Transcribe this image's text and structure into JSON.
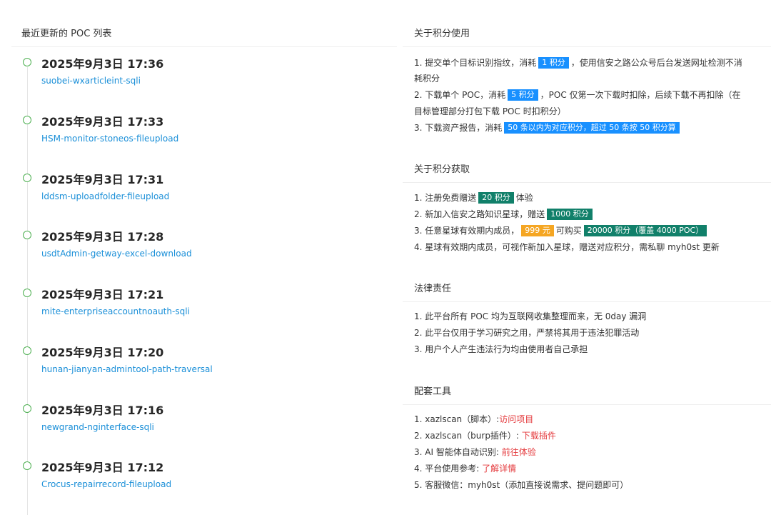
{
  "left": {
    "header": "最近更新的 POC 列表",
    "items": [
      {
        "time": "2025年9月3日 17:36",
        "name": "suobei-wxarticleint-sqli"
      },
      {
        "time": "2025年9月3日 17:33",
        "name": "HSM-monitor-stoneos-fileupload"
      },
      {
        "time": "2025年9月3日 17:31",
        "name": "lddsm-uploadfolder-fileupload"
      },
      {
        "time": "2025年9月3日 17:28",
        "name": "usdtAdmin-getway-excel-download"
      },
      {
        "time": "2025年9月3日 17:21",
        "name": "mite-enterpriseaccountnoauth-sqli"
      },
      {
        "time": "2025年9月3日 17:20",
        "name": "hunan-jianyan-admintool-path-traversal"
      },
      {
        "time": "2025年9月3日 17:16",
        "name": "newgrand-nginterface-sqli"
      },
      {
        "time": "2025年9月3日 17:12",
        "name": "Crocus-repairrecord-fileupload"
      }
    ]
  },
  "usage": {
    "title": "关于积分使用",
    "l1_pre": "1. 提交单个目标识别指纹，消耗",
    "l1_badge": "1 积分",
    "l1_post": "，使用信安之路公众号后台发送网址检测不消",
    "l1_cont": "耗积分",
    "l2_pre": "2. 下载单个 POC，消耗",
    "l2_badge": "5 积分",
    "l2_post": "，POC 仅第一次下载时扣除，后续下载不再扣除（在",
    "l2_cont": "目标管理部分打包下载 POC 时扣积分）",
    "l3_pre": "3. 下载资产报告，消耗",
    "l3_badge": "50 条以内为对应积分，超过 50 条按 50 积分算"
  },
  "earn": {
    "title": "关于积分获取",
    "l1_pre": "1. 注册免费赠送",
    "l1_badge": "20 积分",
    "l1_post": "体验",
    "l2_pre": "2. 新加入信安之路知识星球，赠送",
    "l2_badge": "1000 积分",
    "l3_pre": "3. 任意星球有效期内成员，",
    "l3_badge1": "999 元",
    "l3_mid": "可购买",
    "l3_badge2": "20000 积分（覆盖 4000 POC）",
    "l4": "4. 星球有效期内成员，可视作新加入星球，赠送对应积分，需私聊 myh0st 更新"
  },
  "legal": {
    "title": "法律责任",
    "l1": "1. 此平台所有 POC 均为互联网收集整理而来，无 0day 漏洞",
    "l2": "2. 此平台仅用于学习研究之用，严禁将其用于违法犯罪活动",
    "l3": "3. 用户个人产生违法行为均由使用者自己承担"
  },
  "tools": {
    "title": "配套工具",
    "l1_pre": "1. xazlscan（脚本）:",
    "l1_link": "访问项目",
    "l2_pre": "2. xazlscan（burp插件）:",
    "l2_link": "下载插件",
    "l3_pre": "3. AI 智能体自动识别:",
    "l3_link": "前往体验",
    "l4_pre": "4. 平台使用参考:",
    "l4_link": "了解详情",
    "l5": "5. 客服微信：myh0st（添加直接说需求、提问题即可）"
  },
  "colors": {
    "link_blue": "#1a8fd8",
    "badge_blue": "#1890ff",
    "badge_green": "#11806a",
    "badge_orange": "#f5a623",
    "link_red": "#e4393c",
    "timeline_dot": "#4caf50"
  }
}
